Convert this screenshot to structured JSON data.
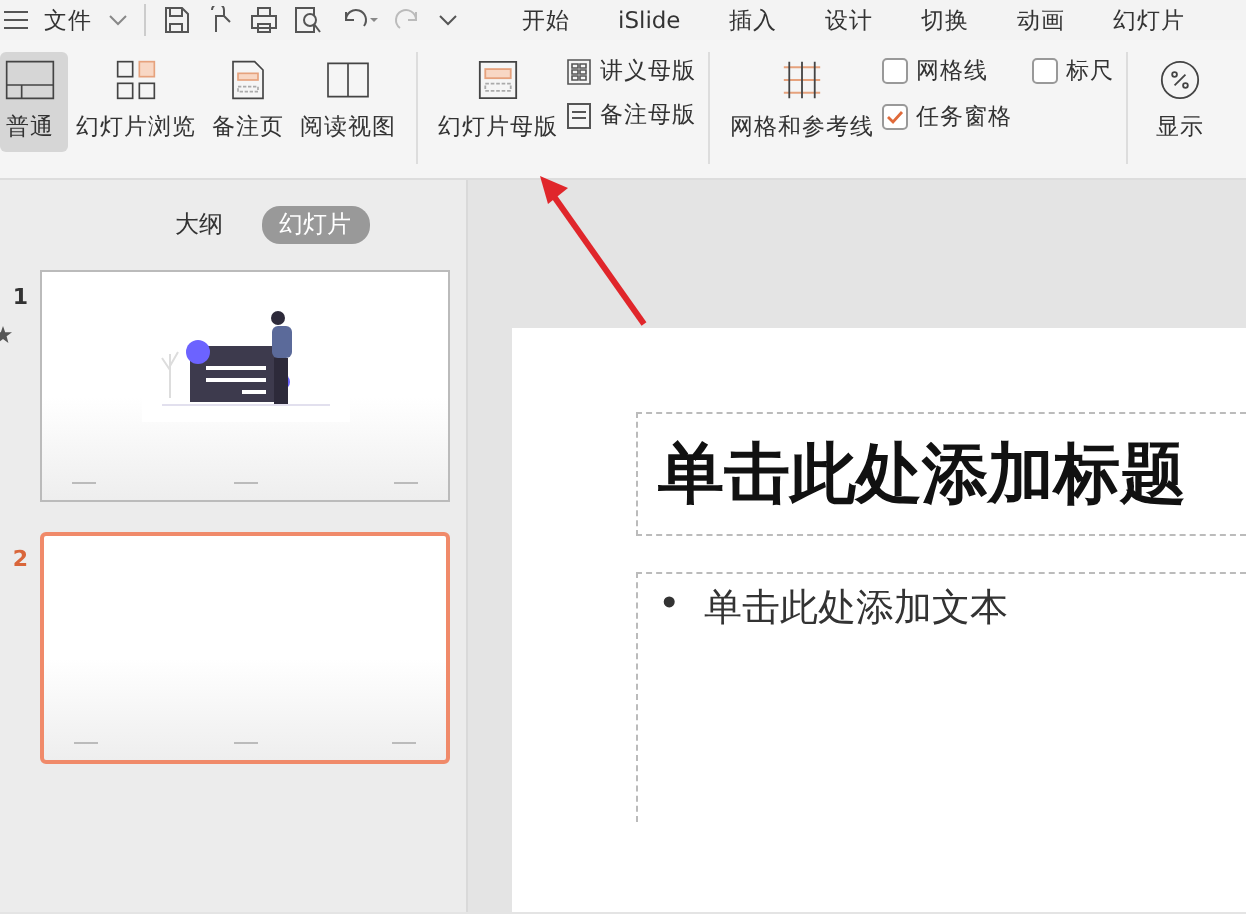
{
  "menu": {
    "file": "文件"
  },
  "tabs": [
    {
      "label": "开始",
      "selected": false
    },
    {
      "label": "iSlide",
      "selected": false
    },
    {
      "label": "插入",
      "selected": false
    },
    {
      "label": "设计",
      "selected": false
    },
    {
      "label": "切换",
      "selected": false
    },
    {
      "label": "动画",
      "selected": false
    },
    {
      "label": "幻灯片",
      "selected": false
    }
  ],
  "ribbon": {
    "views": [
      {
        "label": "普通",
        "selected": true
      },
      {
        "label": "幻灯片浏览",
        "selected": false
      },
      {
        "label": "备注页",
        "selected": false
      },
      {
        "label": "阅读视图",
        "selected": false
      }
    ],
    "master": {
      "label": "幻灯片母版"
    },
    "small": [
      {
        "label": "讲义母版"
      },
      {
        "label": "备注母版"
      }
    ],
    "grid": {
      "label": "网格和参考线"
    },
    "checks": [
      {
        "label": "网格线",
        "checked": false
      },
      {
        "label": "标尺",
        "checked": false
      },
      {
        "label": "任务窗格",
        "checked": true
      }
    ],
    "zoom": {
      "label": "显示"
    }
  },
  "panel": {
    "tabs": [
      {
        "label": "大纲",
        "selected": false
      },
      {
        "label": "幻灯片",
        "selected": true
      }
    ],
    "slides": [
      {
        "number": "1",
        "selected": false,
        "kind": "picture"
      },
      {
        "number": "2",
        "selected": true,
        "kind": "blank"
      }
    ]
  },
  "slide": {
    "title_placeholder": "单击此处添加标题",
    "body_placeholder": "单击此处添加文本",
    "bullet": "•"
  }
}
